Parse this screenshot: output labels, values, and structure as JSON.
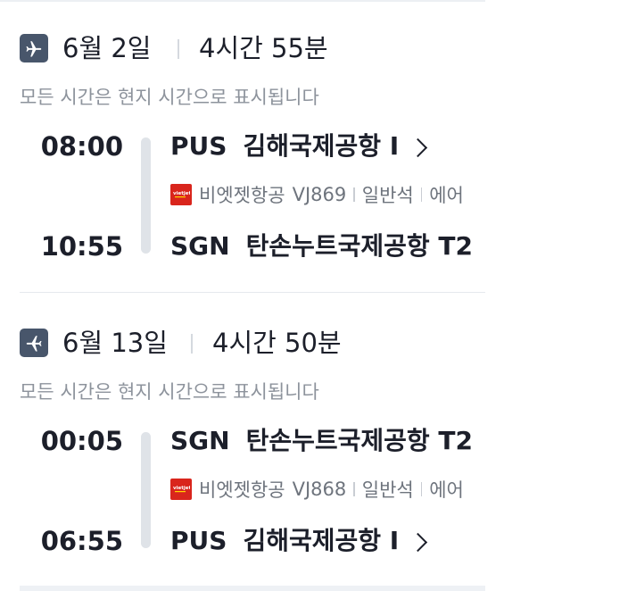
{
  "segments": [
    {
      "date": "6월 2일",
      "duration": "4시간 55분",
      "timezone_note": "모든 시간은 현지 시간으로 표시됩니다",
      "departure": {
        "time": "08:00",
        "code": "PUS",
        "airport": "김해국제공항 I"
      },
      "flight": {
        "airline": "비엣젯항공",
        "number": "VJ869",
        "cabin": "일반석",
        "extra": "에어"
      },
      "arrival": {
        "time": "10:55",
        "code": "SGN",
        "airport": "탄손누트국제공항 T2"
      }
    },
    {
      "date": "6월 13일",
      "duration": "4시간 50분",
      "timezone_note": "모든 시간은 현지 시간으로 표시됩니다",
      "departure": {
        "time": "00:05",
        "code": "SGN",
        "airport": "탄손누트국제공항 T2"
      },
      "flight": {
        "airline": "비엣젯항공",
        "number": "VJ868",
        "cabin": "일반석",
        "extra": "에어"
      },
      "arrival": {
        "time": "06:55",
        "code": "PUS",
        "airport": "김해국제공항 I"
      }
    }
  ],
  "colors": {
    "text": "#1c1f2a",
    "muted": "#8d939c",
    "icon_bg": "#48566b",
    "timeline": "#dfe3e8",
    "airline_logo": "#d9251c"
  },
  "icons": [
    "airplane-icon",
    "chevron-right-icon",
    "vietjet-logo"
  ]
}
